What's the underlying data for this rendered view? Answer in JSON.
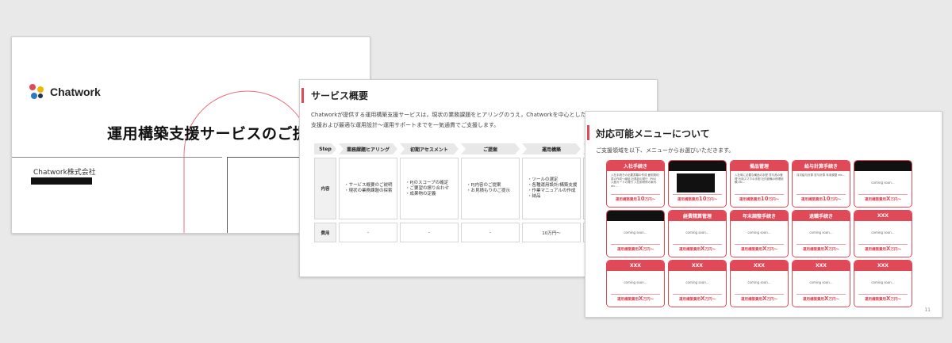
{
  "slide1": {
    "logo_text": "Chatwork",
    "title": "運用構築支援サービスのご提案",
    "company": "Chatwork株式会社",
    "brand_colors": {
      "red": "#e04958",
      "yellow": "#f5b400",
      "blue": "#2e78c8",
      "dark": "#23324a"
    }
  },
  "slide2": {
    "title": "サービス概要",
    "desc_line1": "Chatworkが提供する運用構築支援サービスは，現状の業務課題をヒアリングのうえ，Chatworkを中心としたITツールの導入",
    "desc_line2": "支援および最適な運用設計〜運用サポートまでを一気通貫でご支援します。",
    "step_label": "Step",
    "steps": [
      "業務課題ヒアリング",
      "初期アセスメント",
      "ご提案",
      "運用構築"
    ],
    "content_label": "内容",
    "contents": [
      [
        "・サービス概要のご説明",
        "・現状の業務課題の探索"
      ],
      [
        "・PJのスコープの確定",
        "・ご要望の擦り合わせ",
        "・成果物の定義"
      ],
      [
        "・PJ内容のご提案",
        "・お見積もりのご提示"
      ],
      [
        "・ツールの選定",
        "・各種運用設計/構築支援",
        "・作業マニュアルの作成",
        "・納品"
      ]
    ],
    "fee_label": "費用",
    "fees": [
      "-",
      "-",
      "-",
      "10万円〜"
    ]
  },
  "slide3": {
    "title": "対応可能メニューについて",
    "desc": "ご支援領域を以下、メニューからお選びいただきます。",
    "page_number": "11",
    "price_label": "運用構築費用",
    "cards": [
      {
        "title": "入社手続き",
        "body": "入社手続きの必要書類の作成 雇用契約書の作成〜締結 社員証の発行（PIN） 入館カードの発行 入社前研修の案内 etc...",
        "price_num": "10",
        "price_unit": "万円〜"
      },
      {
        "title": "",
        "redact_head": true,
        "redact_body": true,
        "price_num": "10",
        "price_unit": "万円〜"
      },
      {
        "title": "備品管理",
        "body": "入社時に必要な備品の手配 貸与品の管理 社用スマホの手配 社内設備の修理依頼 etc...",
        "price_num": "10",
        "price_unit": "万円〜"
      },
      {
        "title": "給与計算手続き",
        "body": "月次給与計算 賞与計算 年末調整 etc...",
        "price_num": "10",
        "price_unit": "万円〜"
      },
      {
        "title": "",
        "redact_head": true,
        "body": "coming soon...",
        "soon": true,
        "price_num": "X",
        "price_unit": "万円〜"
      },
      {
        "title": "",
        "redact_head": true,
        "body": "coming soon...",
        "soon": true,
        "price_num": "X",
        "price_unit": "万円〜"
      },
      {
        "title": "経費精算管理",
        "body": "coming soon...",
        "soon": true,
        "price_num": "X",
        "price_unit": "万円〜"
      },
      {
        "title": "年末調整手続き",
        "body": "coming soon...",
        "soon": true,
        "price_num": "X",
        "price_unit": "万円〜"
      },
      {
        "title": "退職手続き",
        "body": "coming soon...",
        "soon": true,
        "price_num": "X",
        "price_unit": "万円〜"
      },
      {
        "title": "XXX",
        "body": "coming soon...",
        "soon": true,
        "price_num": "X",
        "price_unit": "万円〜"
      },
      {
        "title": "XXX",
        "body": "coming soon...",
        "soon": true,
        "price_num": "X",
        "price_unit": "万円〜"
      },
      {
        "title": "XXX",
        "body": "coming soon...",
        "soon": true,
        "price_num": "X",
        "price_unit": "万円〜"
      },
      {
        "title": "XXX",
        "body": "coming soon...",
        "soon": true,
        "price_num": "X",
        "price_unit": "万円〜"
      },
      {
        "title": "XXX",
        "body": "coming soon...",
        "soon": true,
        "price_num": "X",
        "price_unit": "万円〜"
      },
      {
        "title": "XXX",
        "body": "coming soon...",
        "soon": true,
        "price_num": "X",
        "price_unit": "万円〜"
      }
    ]
  }
}
